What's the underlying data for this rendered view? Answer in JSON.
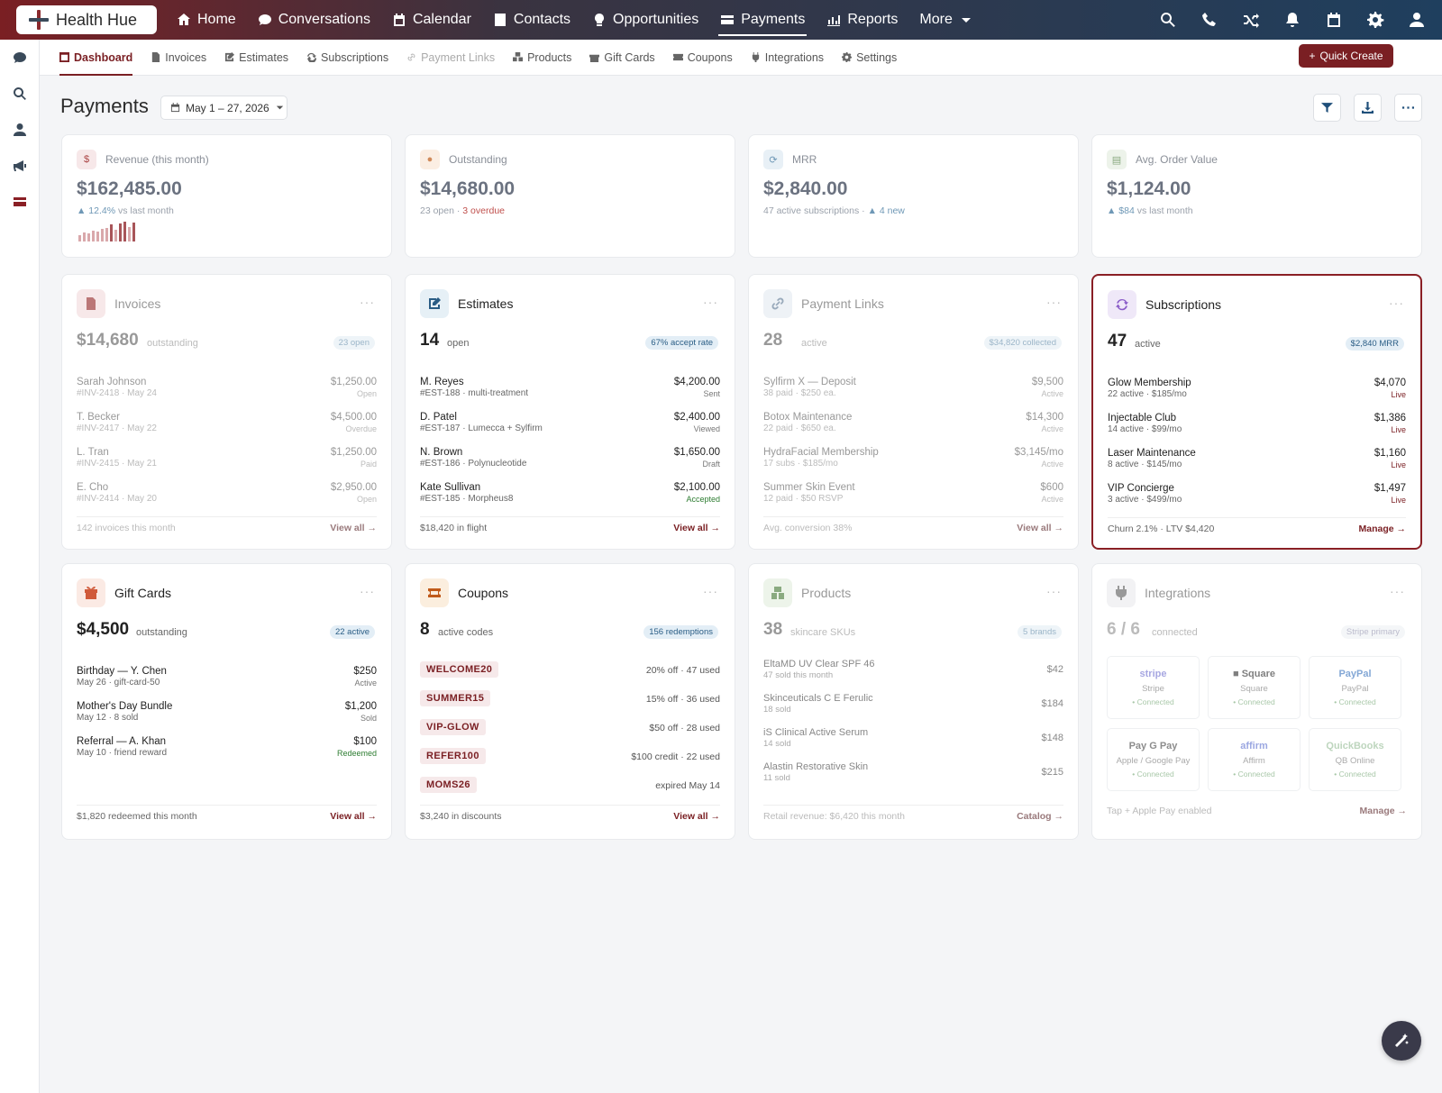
{
  "app": {
    "name": "Health Hue"
  },
  "nav": {
    "items": [
      "Home",
      "Conversations",
      "Calendar",
      "Contacts",
      "Opportunities",
      "Payments",
      "Reports",
      "More"
    ]
  },
  "subnav": {
    "items": [
      "Dashboard",
      "Invoices",
      "Estimates",
      "Subscriptions",
      "Payment Links",
      "Products",
      "Gift Cards",
      "Coupons",
      "Integrations",
      "Settings"
    ]
  },
  "quick_create": "Quick Create",
  "page": {
    "title": "Payments",
    "date_range": "May 1 – 27, 2026"
  },
  "stats": [
    {
      "label": "Revenue (this month)",
      "value": "$162,485.00",
      "sub1": "▲ 12.4%",
      "sub2": " vs last month",
      "icon": "dollar-icon",
      "spark": [
        0.3,
        0.45,
        0.4,
        0.55,
        0.5,
        0.65,
        0.7,
        0.85,
        0.6,
        0.9,
        1.0,
        0.75,
        0.95
      ]
    },
    {
      "label": "Outstanding",
      "value": "$14,680.00",
      "sub1": "23 open · ",
      "sub2": "3 overdue",
      "icon": "alert-icon"
    },
    {
      "label": "MRR",
      "value": "$2,840.00",
      "sub1": "47 active subscriptions · ",
      "sub2": "▲ 4 new",
      "icon": "refresh-icon"
    },
    {
      "label": "Avg. Order Value",
      "value": "$1,124.00",
      "sub1": "▲ $84",
      "sub2": " vs last month",
      "icon": "receipt-icon"
    }
  ],
  "invoices": {
    "title": "Invoices",
    "big": "$14,680",
    "big_sub": "outstanding",
    "pill": "23 open",
    "rows": [
      {
        "name": "Sarah Johnson",
        "meta": "#INV-2418 · May 24",
        "amount": "$1,250.00",
        "status": "Open"
      },
      {
        "name": "T. Becker",
        "meta": "#INV-2417 · May 22",
        "amount": "$4,500.00",
        "status": "Overdue"
      },
      {
        "name": "L. Tran",
        "meta": "#INV-2415 · May 21",
        "amount": "$1,250.00",
        "status": "Paid"
      },
      {
        "name": "E. Cho",
        "meta": "#INV-2414 · May 20",
        "amount": "$2,950.00",
        "status": "Open"
      }
    ],
    "foot": "142 invoices this month",
    "link": "View all →"
  },
  "estimates": {
    "title": "Estimates",
    "big": "14",
    "big_sub": "open",
    "pill": "67% accept rate",
    "rows": [
      {
        "name": "M. Reyes",
        "meta": "#EST-188 · multi-treatment",
        "amount": "$4,200.00",
        "status": "Sent"
      },
      {
        "name": "D. Patel",
        "meta": "#EST-187 · Lumecca + Sylfirm",
        "amount": "$2,400.00",
        "status": "Viewed"
      },
      {
        "name": "N. Brown",
        "meta": "#EST-186 · Polynucleotide",
        "amount": "$1,650.00",
        "status": "Draft"
      },
      {
        "name": "Kate Sullivan",
        "meta": "#EST-185 · Morpheus8",
        "amount": "$2,100.00",
        "status": "Accepted"
      }
    ],
    "foot": "$18,420 in flight",
    "link": "View all →"
  },
  "payment_links": {
    "title": "Payment Links",
    "big": "28",
    "big_sub": "active",
    "pill": "$34,820 collected",
    "rows": [
      {
        "name": "Sylfirm X — Deposit",
        "meta": "38 paid · $250 ea.",
        "amount": "$9,500",
        "status": "Active"
      },
      {
        "name": "Botox Maintenance",
        "meta": "22 paid · $650 ea.",
        "amount": "$14,300",
        "status": "Active"
      },
      {
        "name": "HydraFacial Membership",
        "meta": "17 subs · $185/mo",
        "amount": "$3,145/mo",
        "status": "Active"
      },
      {
        "name": "Summer Skin Event",
        "meta": "12 paid · $50 RSVP",
        "amount": "$600",
        "status": "Active"
      }
    ],
    "foot": "Avg. conversion 38%",
    "link": "View all →"
  },
  "subscriptions": {
    "title": "Subscriptions",
    "big": "47",
    "big_sub": "active",
    "pill": "$2,840 MRR",
    "rows": [
      {
        "name": "Glow Membership",
        "meta": "22 active · $185/mo",
        "amount": "$4,070",
        "status": "Live"
      },
      {
        "name": "Injectable Club",
        "meta": "14 active · $99/mo",
        "amount": "$1,386",
        "status": "Live"
      },
      {
        "name": "Laser Maintenance",
        "meta": "8 active · $145/mo",
        "amount": "$1,160",
        "status": "Live"
      },
      {
        "name": "VIP Concierge",
        "meta": "3 active · $499/mo",
        "amount": "$1,497",
        "status": "Live"
      }
    ],
    "foot": "Churn 2.1% · LTV $4,420",
    "link": "Manage →"
  },
  "gift_cards": {
    "title": "Gift Cards",
    "big": "$4,500",
    "big_sub": "outstanding",
    "pill": "22 active",
    "rows": [
      {
        "name": "Birthday — Y. Chen",
        "meta": "May 26 · gift-card-50",
        "amount": "$250",
        "status": "Active"
      },
      {
        "name": "Mother's Day Bundle",
        "meta": "May 12 · 8 sold",
        "amount": "$1,200",
        "status": "Sold"
      },
      {
        "name": "Referral — A. Khan",
        "meta": "May 10 · friend reward",
        "amount": "$100",
        "status": "Redeemed"
      }
    ],
    "foot": "$1,820 redeemed this month",
    "link": "View all →"
  },
  "coupons": {
    "title": "Coupons",
    "big": "8",
    "big_sub": "active codes",
    "pill": "156 redemptions",
    "rows": [
      {
        "code": "WELCOME20",
        "desc": "20% off · 47 used"
      },
      {
        "code": "SUMMER15",
        "desc": "15% off · 36 used"
      },
      {
        "code": "VIP-GLOW",
        "desc": "$50 off · 28 used"
      },
      {
        "code": "REFER100",
        "desc": "$100 credit · 22 used"
      },
      {
        "code": "MOMS26",
        "desc": "expired May 14"
      }
    ],
    "foot": "$3,240 in discounts",
    "link": "View all →"
  },
  "products": {
    "title": "Products",
    "big": "38",
    "big_sub": "skincare SKUs",
    "pill": "5 brands",
    "rows": [
      {
        "name": "EltaMD UV Clear SPF 46",
        "meta": "47 sold this month",
        "amount": "$42"
      },
      {
        "name": "Skinceuticals C E Ferulic",
        "meta": "18 sold",
        "amount": "$184"
      },
      {
        "name": "iS Clinical Active Serum",
        "meta": "14 sold",
        "amount": "$148"
      },
      {
        "name": "Alastin Restorative Skin",
        "meta": "11 sold",
        "amount": "$215"
      }
    ],
    "foot": "Retail revenue: $6,420 this month",
    "link": "Catalog →"
  },
  "integrations": {
    "title": "Integrations",
    "big": "6 / 6",
    "big_sub": "connected",
    "pill": "Stripe primary",
    "items": [
      {
        "logo": "stripe",
        "name": "Stripe",
        "status": "• Connected",
        "color": "#8a8ad8"
      },
      {
        "logo": "■ Square",
        "name": "Square",
        "status": "• Connected",
        "color": "#555"
      },
      {
        "logo": "PayPal",
        "name": "PayPal",
        "status": "• Connected",
        "color": "#5a8ac8"
      },
      {
        "logo": "Pay G Pay",
        "name": "Apple / Google Pay",
        "status": "• Connected",
        "color": "#666"
      },
      {
        "logo": "affirm",
        "name": "Affirm",
        "status": "• Connected",
        "color": "#7a8ad8"
      },
      {
        "logo": "QuickBooks",
        "name": "QB Online",
        "status": "• Connected",
        "color": "#a8c8a8"
      }
    ],
    "foot": "Tap + Apple Pay enabled",
    "link": "Manage →"
  }
}
